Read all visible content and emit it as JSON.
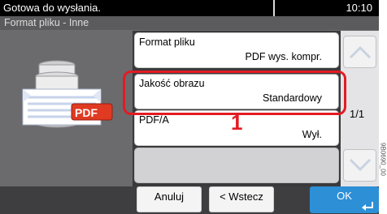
{
  "status": {
    "message": "Gotowa do wysłania.",
    "time": "10:10"
  },
  "screen_title": "Format pliku - Inne",
  "illustration": {
    "badge": "PDF"
  },
  "settings": [
    {
      "label": "Format pliku",
      "value": "PDF wys. kompr."
    },
    {
      "label": "Jakość obrazu",
      "value": "Standardowy"
    },
    {
      "label": "PDF/A",
      "value": "Wył."
    }
  ],
  "callout_number": "1",
  "pager": "1/1",
  "buttons": {
    "cancel": "Anuluj",
    "back": "< Wstecz",
    "ok": "OK"
  },
  "side_code": "9B0690_00",
  "colors": {
    "highlight": "#e31b23",
    "ok_button": "#2d8fd6",
    "pdf_badge": "#e03a22"
  }
}
